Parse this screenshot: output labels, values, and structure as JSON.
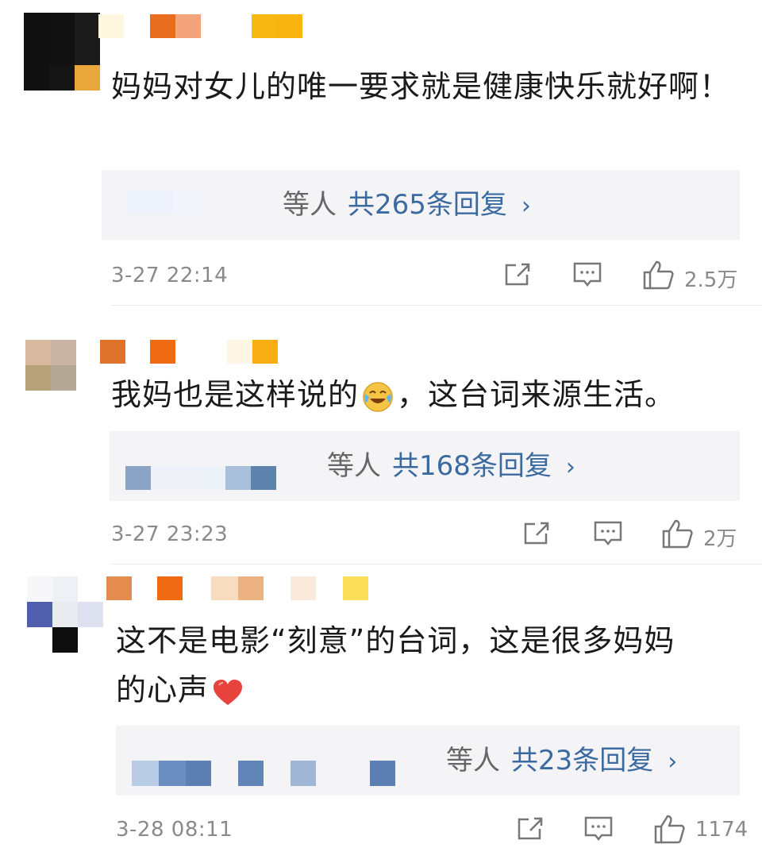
{
  "colors": {
    "reply_link": "#3b6aa0",
    "meta_gray": "#8a8a8a",
    "reply_bg": "#f4f4f6",
    "heart": "#e8423d"
  },
  "comments": [
    {
      "text": "妈妈对女儿的唯一要求就是健康快乐就好啊！",
      "reply_suffix": "等人",
      "reply_link": "共265条回复",
      "chevron": "›",
      "time": "3-27 22:14",
      "likes": "2.5万",
      "icons": [
        "share-icon",
        "comment-icon",
        "thumbs-up-icon"
      ]
    },
    {
      "text_before_emoji": "我妈也是这样说的",
      "emoji": "laugh-cry-emoji",
      "text_after_emoji": "，这台词来源生活。",
      "reply_suffix": "等人",
      "reply_link": "共168条回复",
      "chevron": "›",
      "time": "3-27 23:23",
      "likes": "2万",
      "icons": [
        "share-icon",
        "comment-icon",
        "thumbs-up-icon"
      ]
    },
    {
      "text_line1": "这不是电影“刻意”的台词，这是很多妈妈",
      "text_line2": "的心声",
      "emoji": "red-heart-emoji",
      "reply_suffix": "等人",
      "reply_link": "共23条回复",
      "chevron": "›",
      "time": "3-28 08:11",
      "likes": "1174",
      "icons": [
        "share-icon",
        "comment-icon",
        "thumbs-up-icon"
      ]
    }
  ]
}
